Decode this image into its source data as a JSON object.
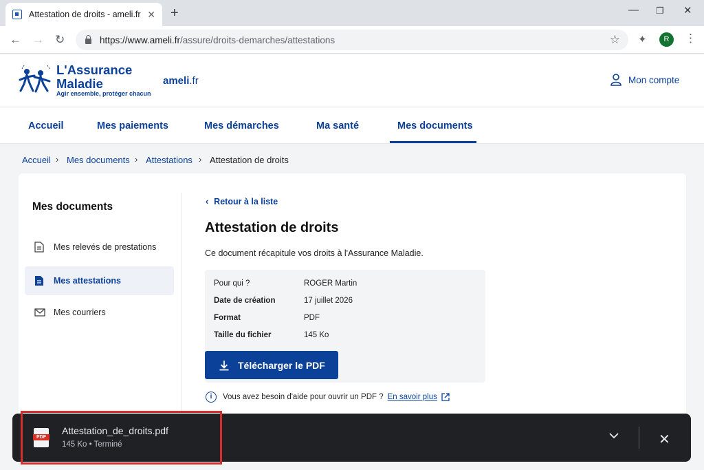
{
  "browser": {
    "tab_title": "Attestation de droits - ameli.fr",
    "tab_close": "✕",
    "new_tab": "+",
    "url_host": "https://www.ameli.fr",
    "url_path": "/assure/droits-demarches/attestations",
    "profile_initial": "R"
  },
  "site": {
    "brand_line1": "L'Assurance",
    "brand_line2": "Maladie",
    "brand_tagline": "Agir ensemble, protéger chacun",
    "ameli_name": "ameli",
    "ameli_tld": ".fr",
    "account_label": "Mon compte"
  },
  "nav": {
    "items": [
      "Accueil",
      "Mes paiements",
      "Mes démarches",
      "Ma santé",
      "Mes documents"
    ],
    "active": "Mes documents"
  },
  "breadcrumb": [
    "Accueil",
    "Mes documents",
    "Attestations",
    "Attestation de droits"
  ],
  "sidebar": {
    "title": "Mes documents",
    "items": [
      {
        "label": "Mes relevés de prestations",
        "icon": "document-icon"
      },
      {
        "label": "Mes attestations",
        "icon": "document-filled-icon",
        "active": true
      },
      {
        "label": "Mes courriers",
        "icon": "envelope-icon"
      }
    ]
  },
  "document": {
    "back_label": "Retour à la liste",
    "title": "Attestation de droits",
    "description": "Ce document récapitule vos droits à l'Assurance Maladie.",
    "info": [
      {
        "key": "Pour qui ?",
        "value": "ROGER Martin"
      },
      {
        "key": "Date de création",
        "value": "17 juillet 2026"
      },
      {
        "key": "Format",
        "value": "PDF"
      },
      {
        "key": "Taille du fichier",
        "value": "145 Ko"
      }
    ],
    "download_label": "Télécharger le PDF",
    "help_text": "Vous avez besoin d'aide pour ouvrir un PDF ?",
    "help_link": "En savoir plus"
  },
  "download_bar": {
    "file_name": "Attestation_de_droits.pdf",
    "status": "145 Ko • Terminé",
    "file_type_label": "PDF"
  },
  "colors": {
    "brand_blue": "#0c419a",
    "highlight_red": "#d32f2f",
    "download_bar_bg": "#202124"
  }
}
